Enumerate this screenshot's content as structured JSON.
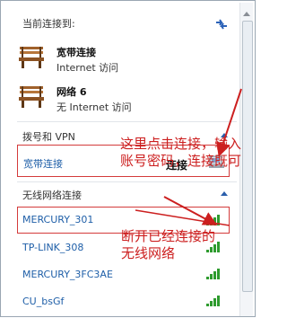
{
  "current_connections": {
    "label": "当前连接到:",
    "items": [
      {
        "name": "宽带连接",
        "status": "Internet 访问"
      },
      {
        "name": "网络  6",
        "status": "无 Internet 访问"
      }
    ]
  },
  "vpn_section": {
    "label": "拨号和 VPN",
    "item_name": "宽带连接",
    "connect_button": "连接"
  },
  "wireless_section": {
    "label": "无线网络连接",
    "networks": [
      {
        "ssid": "MERCURY_301"
      },
      {
        "ssid": "TP-LINK_308"
      },
      {
        "ssid": "MERCURY_3FC3AE"
      },
      {
        "ssid": "CU_bsGf"
      }
    ]
  },
  "annotations": {
    "vpn_note_line1": "这里点击连接，输入",
    "vpn_note_line2": "账号密码，连接既可",
    "wifi_note_line1": "断开已经连接的",
    "wifi_note_line2": "无线网络"
  },
  "colors": {
    "annotation": "#cc1f1f",
    "link_text": "#1f5fa8",
    "signal_green": "#2e9b2e"
  },
  "icons": {
    "refresh": "refresh-icon",
    "bench": "network-bench-icon",
    "vpn": "dialup-computer-icon",
    "signal": "wifi-signal-icon",
    "collapse": "chevron-up-icon"
  }
}
